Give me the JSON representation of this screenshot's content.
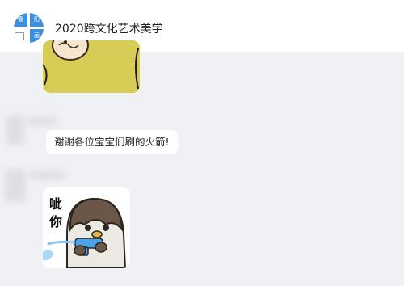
{
  "header": {
    "title": "2020跨文化艺术美学",
    "logo": {
      "top_left": "春",
      "top_right": "阳",
      "bottom_right": "画"
    }
  },
  "messages": [
    {
      "type": "sticker",
      "sender_name_blurred": true
    },
    {
      "type": "text",
      "text": "谢谢各位宝宝们刷的火箭!"
    },
    {
      "type": "sticker",
      "caption": "呲你",
      "sender_name_blurred": true
    }
  ],
  "colors": {
    "header_bg": "#ffffff",
    "chat_bg": "#f0f1f4",
    "accent": "#3d8fe0",
    "bubble": "#ffffff"
  }
}
